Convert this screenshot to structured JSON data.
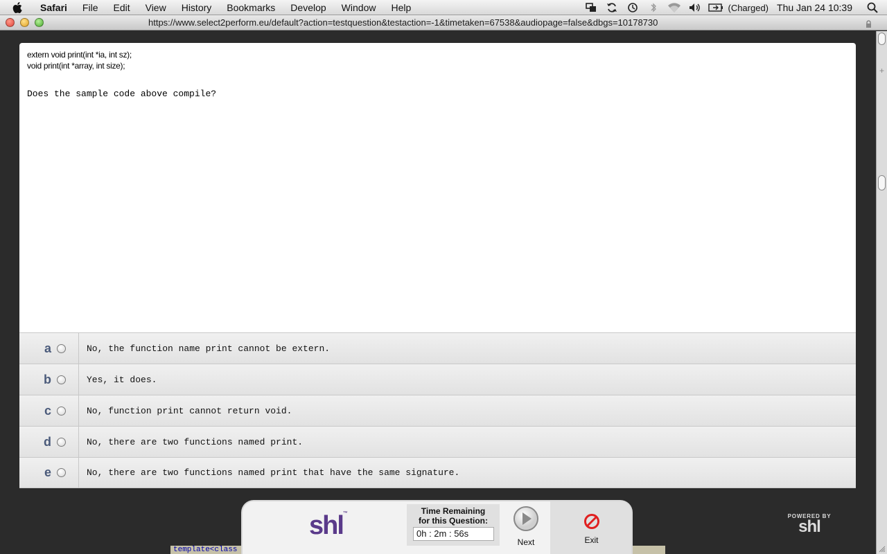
{
  "menubar": {
    "app": "Safari",
    "items": [
      "File",
      "Edit",
      "View",
      "History",
      "Bookmarks",
      "Develop",
      "Window",
      "Help"
    ],
    "battery_status": "(Charged)",
    "clock": "Thu Jan 24  10:39"
  },
  "browser": {
    "url": "https://www.select2perform.eu/default?action=testquestion&testaction=-1&timetaken=67538&audiopage=false&dbgs=10178730"
  },
  "question": {
    "code_lines": [
      "extern void print(int *ia, int sz);",
      "void print(int *array, int size);"
    ],
    "text": "Does the sample code above compile?"
  },
  "answers": [
    {
      "letter": "a",
      "text": "No, the function name print cannot be extern."
    },
    {
      "letter": "b",
      "text": "Yes, it does."
    },
    {
      "letter": "c",
      "text": "No, function print cannot return void."
    },
    {
      "letter": "d",
      "text": "No, there are two functions named print."
    },
    {
      "letter": "e",
      "text": "No, there are two functions named print that have the same signature."
    }
  ],
  "controls": {
    "logo": "shl",
    "logo_tm": "™",
    "timer_label_line1": "Time Remaining",
    "timer_label_line2": "for this Question:",
    "timer_value": "0h : 2m : 56s",
    "next_label": "Next",
    "exit_label": "Exit"
  },
  "powered_by": {
    "text": "POWERED BY",
    "logo": "shl"
  },
  "background_code": "template<class T>",
  "colors": {
    "accent_logo": "#5a3a8a",
    "answer_letter": "#4a5a7a",
    "exit_icon": "#e02020"
  }
}
